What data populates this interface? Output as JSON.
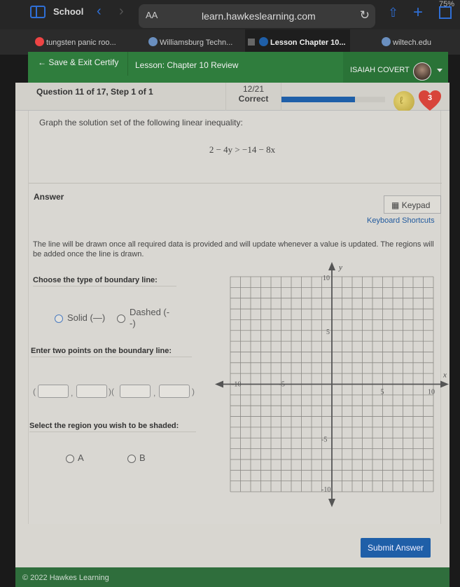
{
  "browser": {
    "status_right": "75%",
    "tab_group": "School",
    "aa_label": "AA",
    "url": "learn.hawkeslearning.com",
    "tabs": [
      {
        "label": "tungsten panic roo..."
      },
      {
        "label": "Williamsburg Techn..."
      },
      {
        "label": "Lesson Chapter 10...",
        "active": true
      },
      {
        "label": "wiltech.edu"
      }
    ]
  },
  "header": {
    "save_exit": "Save & Exit Certify",
    "lesson": "Lesson: Chapter 10 Review",
    "user_name": "ISAIAH COVERT"
  },
  "question_bar": {
    "title": "Question 11 of 17, Step 1 of 1",
    "score": "12/21",
    "score_label": "Correct",
    "progress_fraction": 0.71,
    "hearts": "3"
  },
  "question": {
    "prompt": "Graph the solution set of the following linear inequality:",
    "equation": "2 − 4y > −14 − 8x"
  },
  "answer": {
    "label": "Answer",
    "keypad": "Keypad",
    "shortcuts": "Keyboard Shortcuts",
    "info": "The line will be drawn once all required data is provided and will update whenever a value is updated. The regions will be added once the line is drawn.",
    "boundary_label": "Choose the type of boundary line:",
    "solid_label": "Solid (—)",
    "dashed_label_1": "Dashed (-",
    "dashed_label_2": "-)",
    "points_label": "Enter two points on the boundary line:",
    "points": [
      {
        "x": "",
        "y": ""
      },
      {
        "x": "",
        "y": ""
      }
    ],
    "region_label": "Select the region you wish to be shaded:",
    "region_a": "A",
    "region_b": "B",
    "submit": "Submit Answer"
  },
  "graph": {
    "x_label": "x",
    "y_label": "y",
    "x_min": -10,
    "x_max": 10,
    "y_min": -10,
    "y_max": 10,
    "x_ticks": [
      "-10",
      "-5",
      "5",
      "10"
    ],
    "y_ticks": [
      "10",
      "5",
      "-5",
      "-10"
    ]
  },
  "footer": {
    "copyright": "© 2022 Hawkes Learning"
  }
}
